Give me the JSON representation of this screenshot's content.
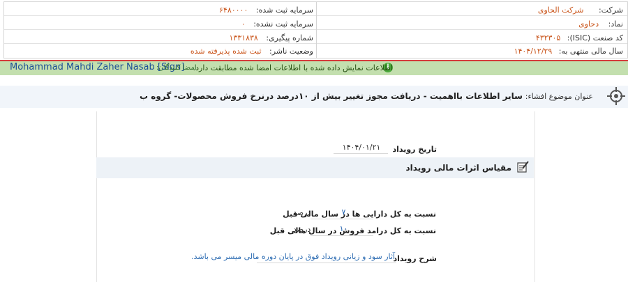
{
  "header": {
    "rows": [
      {
        "right_label": "شرکت:",
        "right_value": "شرکت الحاوی",
        "left_label": "سرمایه ثبت شده:",
        "left_value": "۶۴۸۰۰۰۰"
      },
      {
        "right_label": "نماد:",
        "right_value": "دحاوی",
        "left_label": "سرمایه ثبت نشده:",
        "left_value": "۰"
      },
      {
        "right_label": "کد صنعت (ISIC):",
        "right_value": "۴۳۲۳۰۵",
        "left_label": "شماره پیگیری:",
        "left_value": "۱۳۳۱۸۳۸"
      },
      {
        "right_label": "سال مالی منتهی به:",
        "right_value": "۱۴۰۴/۱۲/۲۹",
        "left_label": "وضعیت ناشر:",
        "left_value": "ثبت شده پذیرفته شده"
      }
    ]
  },
  "signature": {
    "signer_name": "Mohammad Mahdi Zaher Nasab [Sign]",
    "signer_label": "امضا کنندگان:",
    "match_message": "اطلاعات نمایش داده شده با اطلاعات امضا شده مطابقت دارد."
  },
  "subject": {
    "label": "عنوان موضوع افشاء:",
    "text": "سایر اطلاعات بااهمیت - دریافت مجوز تغییر بیش از ۱۰درصد درنرخ فروش محصولات- گروه ب"
  },
  "event": {
    "date_label": "تاریخ رویداد",
    "date_value": "۱۴۰۴/۰۱/۲۱"
  },
  "section": {
    "title": "مقیاس اثرات مالی رویداد",
    "icon": "edit-note-icon"
  },
  "metrics": [
    {
      "label": "نسبت به کل دارایی ها در سال مالی قبل",
      "value": "۷",
      "unit": "درصد"
    },
    {
      "label": "نسبت به کل درامد فروش در سال مالی قبل",
      "value": "۱۰",
      "unit": "درصد"
    }
  ],
  "description": {
    "label": "شرح رویداد",
    "text": "آثار سود و زیانی رویداد فوق در پایان دوره مالی میسر می باشد."
  },
  "colors": {
    "value_orange": "#c9541a",
    "sign_bar_green": "#c3dfae",
    "sign_bar_border_red": "#d63c3c",
    "link_blue": "#1d5fae"
  }
}
